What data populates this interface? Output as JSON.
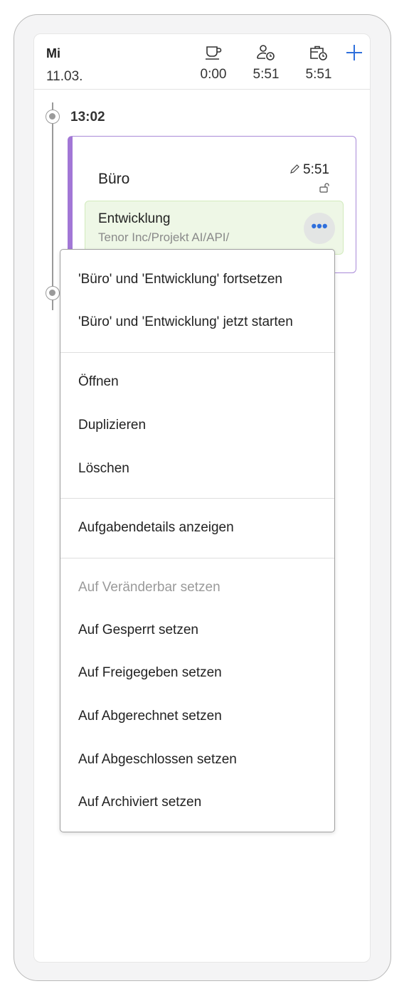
{
  "header": {
    "day": "Mi",
    "date": "11.03.",
    "stats": [
      {
        "icon": "coffee-cup-icon",
        "value": "0:00"
      },
      {
        "icon": "person-clock-icon",
        "value": "5:51"
      },
      {
        "icon": "briefcase-clock-icon",
        "value": "5:51"
      }
    ],
    "add_icon": "plus-icon",
    "accent_color": "#2f6fdc"
  },
  "timeline": {
    "start_time": "13:02"
  },
  "entry": {
    "title": "Büro",
    "duration": "5:51",
    "accent_color": "#a277d6",
    "task": {
      "name": "Entwicklung",
      "path": "Tenor Inc/Projekt AI/API/",
      "background_color": "#eef7e6"
    }
  },
  "menu": {
    "group1": [
      "'Büro' und 'Entwicklung' fortsetzen",
      "'Büro' und 'Entwicklung' jetzt starten"
    ],
    "group2": [
      "Öffnen",
      "Duplizieren",
      "Löschen"
    ],
    "group3": [
      "Aufgabendetails anzeigen"
    ],
    "group4_disabled": "Auf Veränderbar setzen",
    "group4": [
      "Auf Gesperrt setzen",
      "Auf Freigegeben setzen",
      "Auf Abgerechnet setzen",
      "Auf Abgeschlossen setzen",
      "Auf Archiviert setzen"
    ]
  }
}
